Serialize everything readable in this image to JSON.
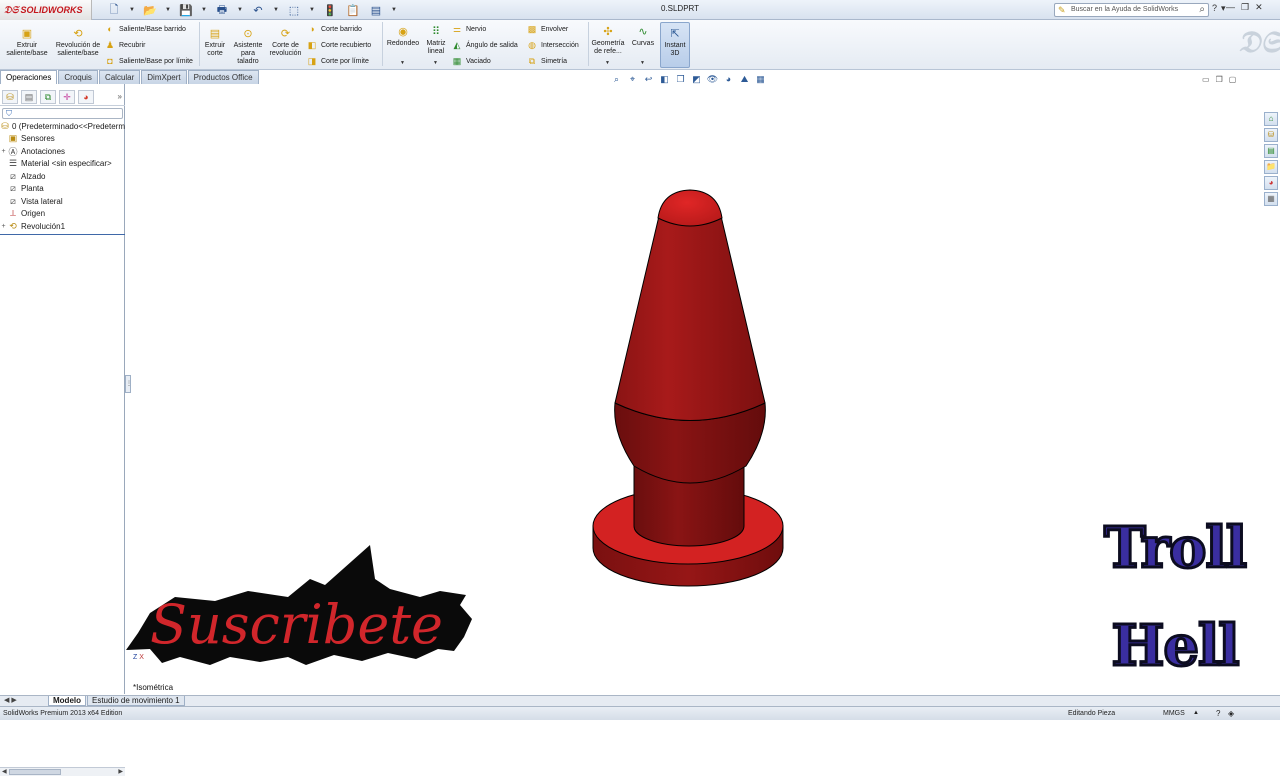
{
  "app": {
    "logo": "SOLIDWORKS",
    "doc_title": "0.SLDPRT",
    "search_placeholder": "Buscar en la Ayuda de SolidWorks"
  },
  "ribbon": {
    "extruir_saliente": "Extruir saliente/base",
    "revolucion_saliente": "Revolución de saliente/base",
    "saliente_barrido": "Saliente/Base barrido",
    "recubrir": "Recubrir",
    "saliente_limite": "Saliente/Base por límite",
    "extruir_corte": "Extruir corte",
    "asistente_taladro": "Asistente para taladro",
    "corte_revolucion": "Corte de revolución",
    "corte_barrido": "Corte barrido",
    "corte_recubierto": "Corte recubierto",
    "corte_limite": "Corte por límite",
    "redondeo": "Redondeo",
    "matriz_lineal": "Matriz lineal",
    "nervio": "Nervio",
    "angulo_salida": "Ángulo de salida",
    "vaciado": "Vaciado",
    "envolver": "Envolver",
    "interseccion": "Intersección",
    "simetria": "Simetría",
    "geometria_ref": "Geometría de refe...",
    "curvas": "Curvas",
    "instant3d": "Instant 3D"
  },
  "tabs": [
    "Operaciones",
    "Croquis",
    "Calcular",
    "DimXpert",
    "Productos Office"
  ],
  "tree": {
    "root": "0  (Predeterminado<<Predeterm",
    "items": [
      "Sensores",
      "Anotaciones",
      "Material <sin especificar>",
      "Alzado",
      "Planta",
      "Vista lateral",
      "Origen",
      "Revolución1"
    ]
  },
  "viewport": {
    "view_name": "*Isométrica",
    "triad_z": "Z",
    "triad_x": "X"
  },
  "bottom_tabs": [
    "Modelo",
    "Estudio de movimiento 1"
  ],
  "status": {
    "edition": "SolidWorks Premium 2013 x64 Edition",
    "mode": "Editando Pieza",
    "units": "MMGS"
  },
  "overlay": {
    "subscribe": "Suscribete",
    "troll": "Troll",
    "hell": "Hell"
  },
  "colors": {
    "part_red": "#a11818",
    "part_highlight": "#d62323",
    "accent_blue": "#3f68a8",
    "subscribe_red": "#d1262b",
    "troll_purple": "#3a2ea0"
  }
}
